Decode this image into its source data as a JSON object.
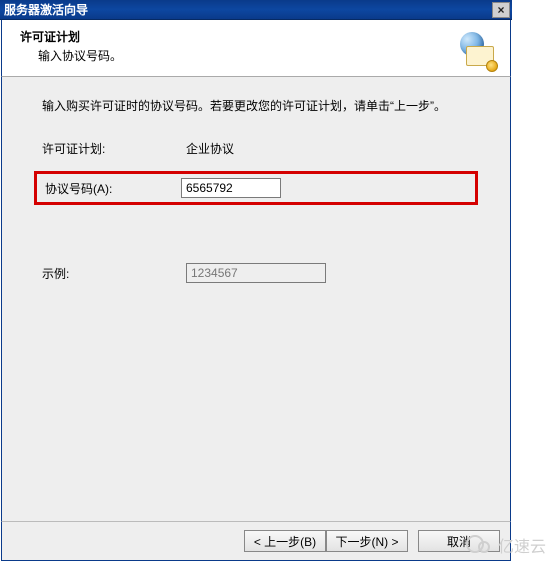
{
  "window": {
    "title": "服务器激活向导",
    "close_label": "×"
  },
  "header": {
    "title": "许可证计划",
    "subtitle": "输入协议号码。"
  },
  "content": {
    "instruction": "输入购买许可证时的协议号码。若要更改您的许可证计划，请单击“上一步”。",
    "plan_label": "许可证计划:",
    "plan_value": "企业协议",
    "agreement_label": "协议号码(A):",
    "agreement_value": "6565792",
    "example_label": "示例:",
    "example_placeholder": "1234567"
  },
  "buttons": {
    "back": "< 上一步(B)",
    "next": "下一步(N) >",
    "cancel": "取消"
  },
  "watermark": "亿速云"
}
